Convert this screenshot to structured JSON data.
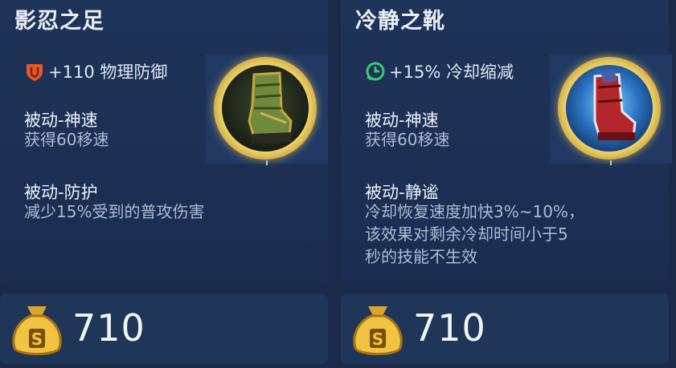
{
  "items": [
    {
      "name": "影忍之足",
      "stat_text": "+110 物理防御",
      "stat_icon": "armor-shield-icon",
      "stat_color": "#e3592b",
      "passives": [
        {
          "name": "被动-神速",
          "desc": "获得60移速"
        },
        {
          "name": "被动-防护",
          "desc": "减少15%受到的普攻伤害"
        }
      ],
      "item_icon": "ninja-boots-icon",
      "price": "710"
    },
    {
      "name": "冷静之靴",
      "stat_text": "+15% 冷却缩减",
      "stat_icon": "cooldown-clock-icon",
      "stat_color": "#3fc87a",
      "passives": [
        {
          "name": "被动-神速",
          "desc": "获得60移速"
        },
        {
          "name": "被动-静谧",
          "desc": "冷却恢复速度加快3%~10%，\n该效果对剩余冷却时间小于5\n秒的技能不生效"
        }
      ],
      "item_icon": "boots-of-tranquility-icon",
      "price": "710"
    }
  ],
  "currency_icon": "gold-coin-bag-icon",
  "colors": {
    "accent_gold": "#f3d05a",
    "panel_bg": "#1f3358"
  }
}
